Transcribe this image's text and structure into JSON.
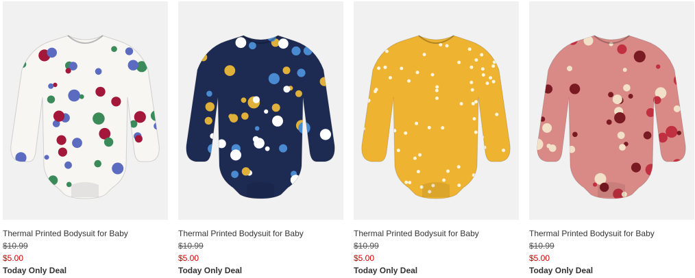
{
  "products": [
    {
      "title": "Thermal Printed Bodysuit for Baby",
      "original_price": "$10.99",
      "sale_price": "$5.00",
      "deal": "Today Only Deal",
      "image_icon": "white-floral-bodysuit-image",
      "colors": {
        "base": "#f7f6f3",
        "print": "#a3173a",
        "accent": "#3a8a5a",
        "accent2": "#5a6bc0"
      }
    },
    {
      "title": "Thermal Printed Bodysuit for Baby",
      "original_price": "$10.99",
      "sale_price": "$5.00",
      "deal": "Today Only Deal",
      "image_icon": "navy-floral-bodysuit-image",
      "colors": {
        "base": "#1d2a52",
        "print": "#e0b13a",
        "accent": "#ffffff",
        "accent2": "#4a8ad0"
      }
    },
    {
      "title": "Thermal Printed Bodysuit for Baby",
      "original_price": "$10.99",
      "sale_price": "$5.00",
      "deal": "Today Only Deal",
      "image_icon": "yellow-heart-bodysuit-image",
      "colors": {
        "base": "#eeb330",
        "print": "#fff4dc",
        "accent": "#fff4dc",
        "accent2": "#fff4dc"
      }
    },
    {
      "title": "Thermal Printed Bodysuit for Baby",
      "original_price": "$10.99",
      "sale_price": "$5.00",
      "deal": "Today Only Deal",
      "image_icon": "pink-floral-bodysuit-image",
      "colors": {
        "base": "#d98a86",
        "print": "#7a1a22",
        "accent": "#c03040",
        "accent2": "#f2e0c8"
      }
    }
  ]
}
